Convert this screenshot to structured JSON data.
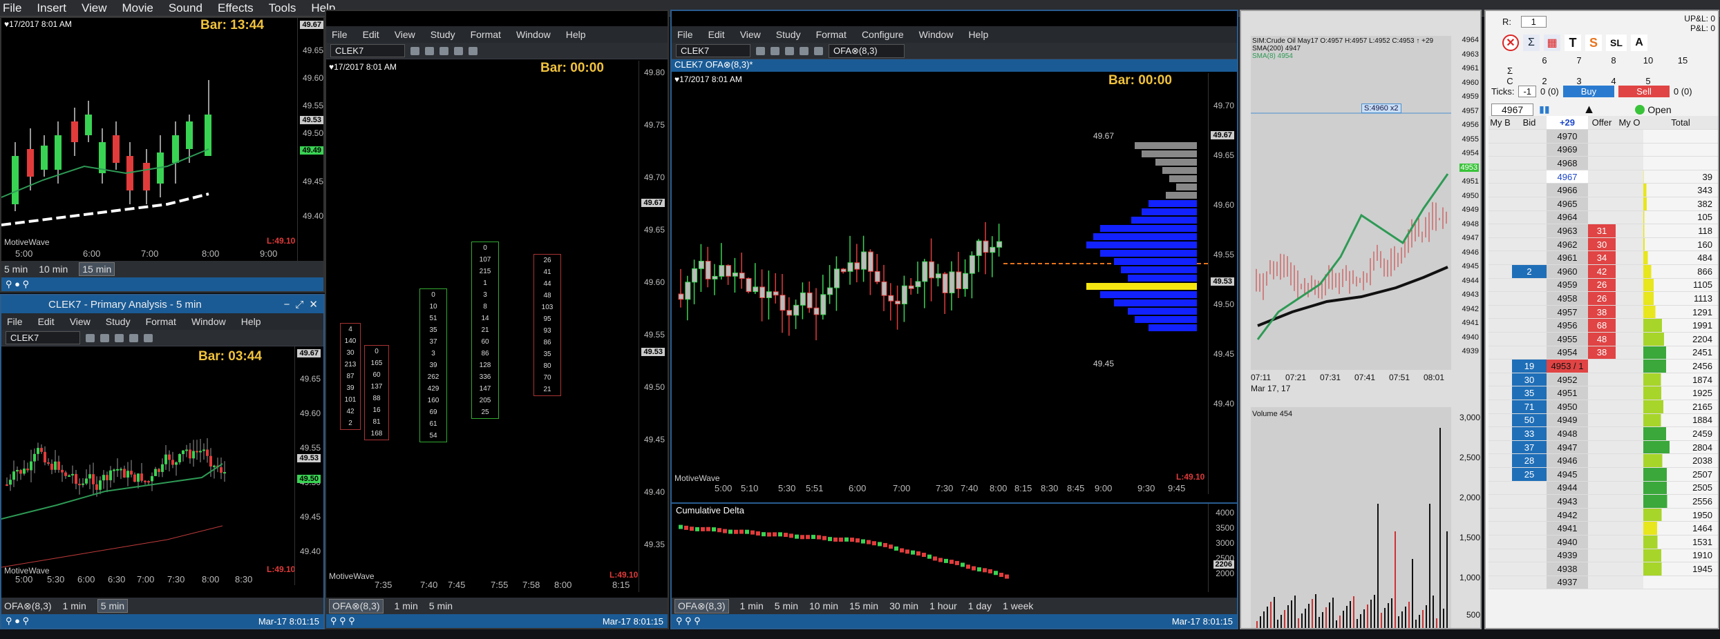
{
  "top_menu": [
    "File",
    "Insert",
    "View",
    "Movie",
    "Sound",
    "Effects",
    "Tools",
    "Help"
  ],
  "menu": {
    "file": "File",
    "edit": "Edit",
    "view": "View",
    "study": "Study",
    "format": "Format",
    "configure": "Configure",
    "window": "Window",
    "help": "Help"
  },
  "win1": {
    "date": "♥17/2017 8:01 AM",
    "bar": "Bar: 13:44",
    "high": "H:49.67",
    "last": "L:49.10",
    "watermark": "MotiveWave",
    "prices": [
      "49.65",
      "49.60",
      "49.55",
      "49.50",
      "49.45",
      "49.40"
    ],
    "tags": [
      "49.67",
      "49.53",
      "49.49"
    ],
    "times": [
      "5:00",
      "6:00",
      "7:00",
      "8:00",
      "9:00"
    ],
    "timeframes": [
      "5 min",
      "10 min",
      "15 min"
    ]
  },
  "win2": {
    "title": "CLEK7 - Primary Analysis - 5 min",
    "symbol": "CLEK7",
    "date": "♥17/2017 8:01 AM",
    "bar": "Bar: 03:44",
    "high": "H:49.67",
    "last": "L:49.10",
    "watermark": "MotiveWave",
    "prices": [
      "49.65",
      "49.60",
      "49.55",
      "49.50",
      "49.45",
      "49.40"
    ],
    "tags": [
      "49.67",
      "49.53",
      "49.50"
    ],
    "times": [
      "5:00",
      "5:30",
      "6:00",
      "6:30",
      "7:00",
      "7:30",
      "8:00",
      "8:30"
    ],
    "timeframes": [
      "OFA⊗(8,3)",
      "1 min",
      "5 min"
    ],
    "status": "Mar-17 8:01:15"
  },
  "win3": {
    "symbol": "CLEK7",
    "date": "♥17/2017 8:01 AM",
    "bar": "Bar: 00:00",
    "high": "H:49.67",
    "last": "L:49.10",
    "watermark": "MotiveWave",
    "prices": [
      "49.80",
      "49.75",
      "49.70",
      "49.65",
      "49.60",
      "49.55",
      "49.50",
      "49.45",
      "49.40",
      "49.35"
    ],
    "tags": [
      "49.67",
      "49.53"
    ],
    "times": [
      "7:35",
      "7:40",
      "7:45",
      "7:55",
      "7:58",
      "8:00",
      "8:15"
    ],
    "timeframes": [
      "OFA⊗(8,3)",
      "1 min",
      "5 min"
    ],
    "status": "Mar-17 8:01:15"
  },
  "win4": {
    "symbol": "CLEK7",
    "tab": "CLEK7 OFA⊗(8,3)*",
    "study": "OFA⊗(8,3)",
    "date": "♥17/2017 8:01 AM",
    "bar": "Bar: 00:00",
    "high": "H:49.67",
    "last": "L:49.10",
    "watermark": "MotiveWave",
    "prices": [
      "49.70",
      "49.65",
      "49.60",
      "49.55",
      "49.50",
      "49.45",
      "49.40"
    ],
    "tags": [
      "49.67",
      "49.53"
    ],
    "profile_hi": "49.67",
    "profile_lo": "49.45",
    "times": [
      "5:00",
      "5:10",
      "5:30",
      "5:51",
      "6:00",
      "7:00",
      "7:30",
      "7:40",
      "8:00",
      "8:15",
      "8:30",
      "8:45",
      "9:00",
      "9:30",
      "9:45"
    ],
    "delta_title": "Cumulative Delta",
    "delta_axis": [
      "4000",
      "3500",
      "3000",
      "2500",
      "2000"
    ],
    "delta_tag": "2206",
    "timeframes": [
      "OFA⊗(8,3)",
      "1 min",
      "5 min",
      "10 min",
      "15 min",
      "30 min",
      "1 hour",
      "1 day",
      "1 week"
    ],
    "status": "Mar-17 8:01:15"
  },
  "win5": {
    "legend": [
      "SIM:Crude Oil May17 O:4957 H:4957 L:4952 C:4953 ↑ +29",
      "SMA(200) 4947",
      "SMA(8) 4954"
    ],
    "order_tag": "S:4960 x2",
    "prices": [
      "4964",
      "4963",
      "4961",
      "4960",
      "4959",
      "4957",
      "4956",
      "4955",
      "4954",
      "4953",
      "4951",
      "4950",
      "4949",
      "4948",
      "4947",
      "4946",
      "4945",
      "4944",
      "4943",
      "4942",
      "4941",
      "4940",
      "4939"
    ],
    "times": [
      "07:11",
      "07:21",
      "07:31",
      "07:41",
      "07:51",
      "08:01"
    ],
    "date": "Mar 17, 17",
    "volume_label": "Volume 454",
    "vol_axis": [
      "3,000",
      "2,500",
      "2,000",
      "1,500",
      "1,000",
      "500"
    ],
    "colors": {
      "sma200": "#111111",
      "sma8": "#2e9a55"
    }
  },
  "dom": {
    "r_label": "R:",
    "r_value": "1",
    "upl": "UP&L:",
    "pl": "P&L:",
    "pl_vals": [
      "0",
      "0"
    ],
    "grid_top": [
      "6",
      "7",
      "8",
      "10",
      "15"
    ],
    "grid_mid": [
      "2",
      "3",
      "4",
      "5"
    ],
    "grid_sigma": "Σ",
    "grid_c": "C",
    "ticks_label": "Ticks:",
    "ticks_value": "-1",
    "ticks_zero": "0 (0)",
    "buy": "Buy",
    "sell": "Sell",
    "price": "4967",
    "delta": "+29",
    "open": "Open",
    "pos": "0 (0)",
    "headers": [
      "My B",
      "Bid",
      "+29",
      "Offer",
      "My O",
      "Total"
    ],
    "rows": [
      {
        "bid": "",
        "price": "4970",
        "offer": "",
        "total": ""
      },
      {
        "bid": "",
        "price": "4969",
        "offer": "",
        "total": ""
      },
      {
        "bid": "",
        "price": "4968",
        "offer": "",
        "total": ""
      },
      {
        "bid": "",
        "price": "4967",
        "offer": "",
        "total": "39"
      },
      {
        "bid": "",
        "price": "4966",
        "offer": "",
        "total": "343"
      },
      {
        "bid": "",
        "price": "4965",
        "offer": "",
        "total": "382"
      },
      {
        "bid": "",
        "price": "4964",
        "offer": "",
        "total": "105"
      },
      {
        "bid": "",
        "price": "4963",
        "offer": "31",
        "total": "118"
      },
      {
        "bid": "",
        "price": "4962",
        "offer": "30",
        "total": "160"
      },
      {
        "bid": "",
        "price": "4961",
        "offer": "34",
        "total": "484"
      },
      {
        "bid": "2",
        "price": "4960",
        "offer": "42",
        "total": "866"
      },
      {
        "bid": "",
        "price": "4959",
        "offer": "26",
        "total": "1105"
      },
      {
        "bid": "",
        "price": "4958",
        "offer": "26",
        "total": "1113"
      },
      {
        "bid": "",
        "price": "4957",
        "offer": "38",
        "total": "1291"
      },
      {
        "bid": "",
        "price": "4956",
        "offer": "68",
        "total": "1991"
      },
      {
        "bid": "",
        "price": "4955",
        "offer": "48",
        "total": "2204"
      },
      {
        "bid": "",
        "price": "4954",
        "offer": "38",
        "total": "2451"
      },
      {
        "bid": "19",
        "price": "4953 / 1",
        "offer": "",
        "total": "2456"
      },
      {
        "bid": "30",
        "price": "4952",
        "offer": "",
        "total": "1874"
      },
      {
        "bid": "35",
        "price": "4951",
        "offer": "",
        "total": "1925"
      },
      {
        "bid": "71",
        "price": "4950",
        "offer": "",
        "total": "2165"
      },
      {
        "bid": "50",
        "price": "4949",
        "offer": "",
        "total": "1884"
      },
      {
        "bid": "33",
        "price": "4948",
        "offer": "",
        "total": "2459"
      },
      {
        "bid": "37",
        "price": "4947",
        "offer": "",
        "total": "2804"
      },
      {
        "bid": "28",
        "price": "4946",
        "offer": "",
        "total": "2038"
      },
      {
        "bid": "25",
        "price": "4945",
        "offer": "",
        "total": "2507"
      },
      {
        "bid": "",
        "price": "4944",
        "offer": "",
        "total": "2505"
      },
      {
        "bid": "",
        "price": "4943",
        "offer": "",
        "total": "2556"
      },
      {
        "bid": "",
        "price": "4942",
        "offer": "",
        "total": "1950"
      },
      {
        "bid": "",
        "price": "4941",
        "offer": "",
        "total": "1464"
      },
      {
        "bid": "",
        "price": "4940",
        "offer": "",
        "total": "1531"
      },
      {
        "bid": "",
        "price": "4939",
        "offer": "",
        "total": "1910"
      },
      {
        "bid": "",
        "price": "4938",
        "offer": "",
        "total": "1945"
      },
      {
        "bid": "",
        "price": "4937",
        "offer": "",
        "total": ""
      }
    ]
  }
}
